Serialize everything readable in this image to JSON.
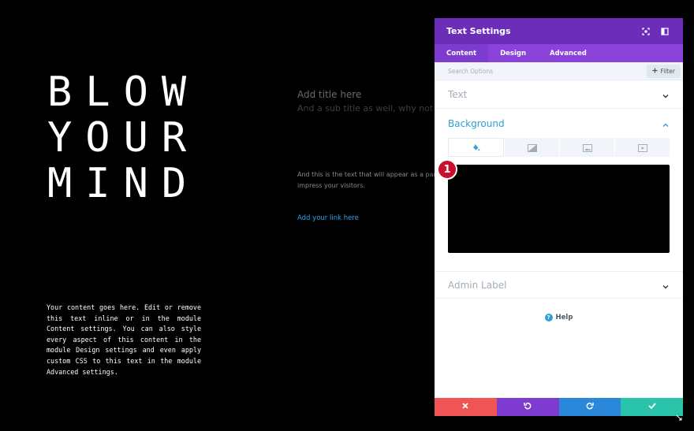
{
  "hero": {
    "lines": [
      "BLOW",
      "YOUR",
      "MIND"
    ],
    "body": "Your content goes here. Edit or remove this text inline or in the module Content settings. You can also style every aspect of this content in the module Design settings and even apply custom CSS to this text in the module Advanced settings."
  },
  "module": {
    "title": "Add title here",
    "subtitle": "And a sub title as well, why not",
    "body_line1": "And this is the text that will appear as a paragraph to",
    "body_line2": "impress your visitors.",
    "link": "Add your link here"
  },
  "panel": {
    "title": "Text Settings",
    "tabs": [
      "Content",
      "Design",
      "Advanced"
    ],
    "search_placeholder": "Search Options",
    "filter_label": "Filter",
    "sections": {
      "text": "Text",
      "background": "Background",
      "admin_label": "Admin Label"
    },
    "marker_number": "1",
    "help_label": "Help"
  },
  "colors": {
    "header": "#6c2eb9",
    "tabs": "#8a42db",
    "accent": "#2e9fd7",
    "cancel": "#ef5555",
    "undo": "#7d3bcf",
    "redo": "#2b87da",
    "save": "#29c4a9"
  },
  "icons": {
    "header": [
      "expand-icon",
      "sidebar-toggle-icon"
    ],
    "background_types": [
      "paint-bucket-icon",
      "gradient-icon",
      "image-icon",
      "video-icon"
    ],
    "footer": [
      "close-icon",
      "undo-icon",
      "redo-icon",
      "check-icon"
    ]
  }
}
